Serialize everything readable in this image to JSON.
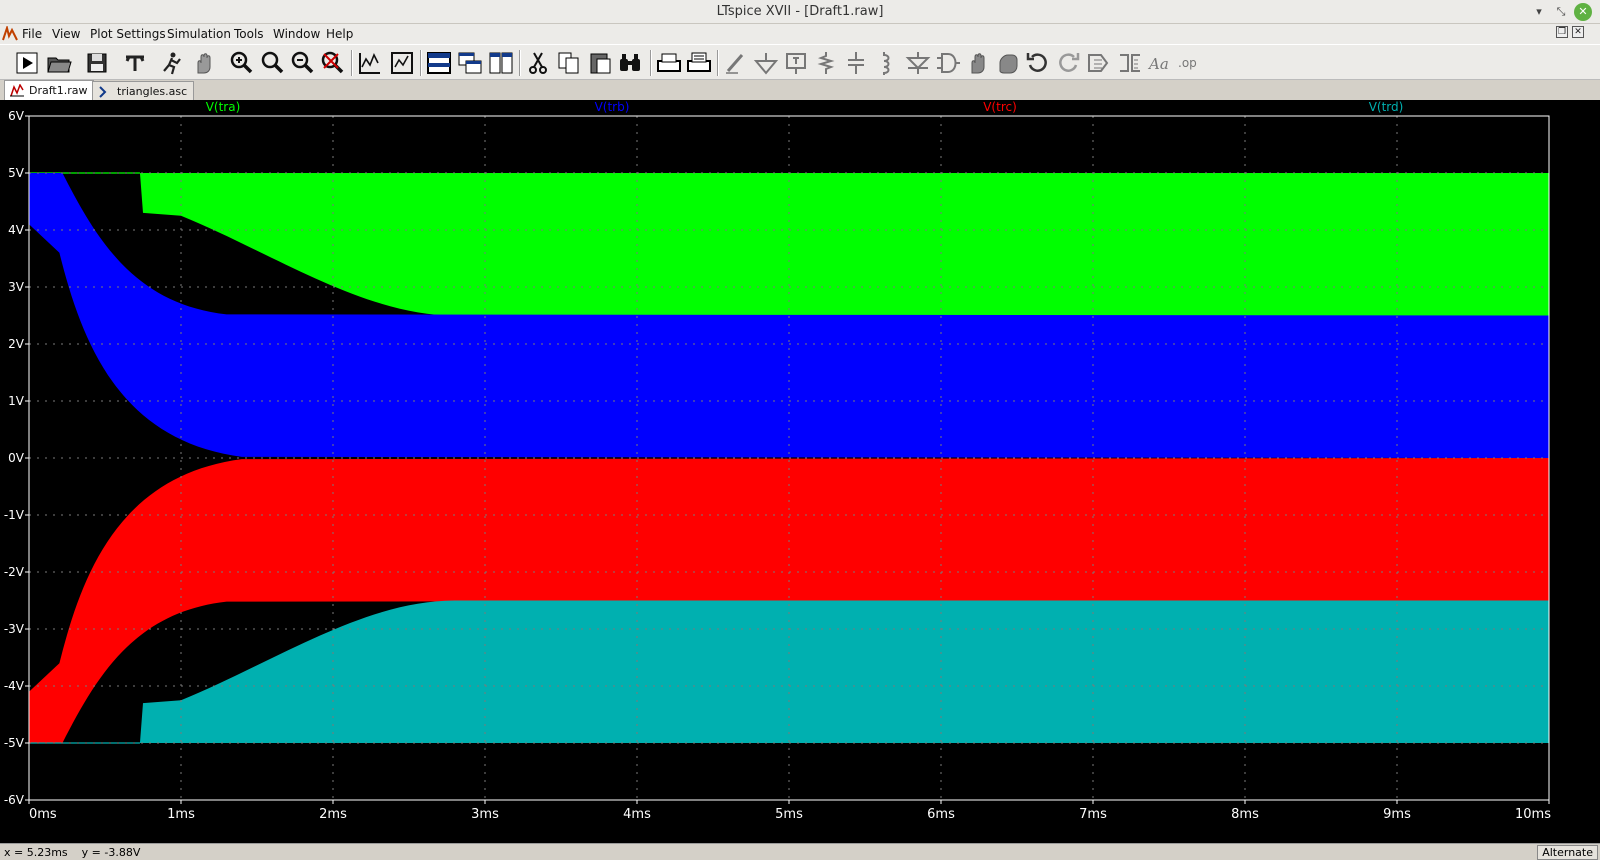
{
  "window": {
    "title": "LTspice XVII - [Draft1.raw]"
  },
  "menu": [
    "File",
    "View",
    "Plot Settings",
    "Simulation",
    "Tools",
    "Window",
    "Help"
  ],
  "tabs": [
    {
      "label": "Draft1.raw",
      "active": true,
      "icon": "waveform-icon"
    },
    {
      "label": "triangles.asc",
      "active": false,
      "icon": "schematic-icon"
    }
  ],
  "toolbar_icons": [
    "run-icon",
    "open-icon",
    "save-icon",
    "control-panel-icon",
    "halt-icon",
    "pan-icon",
    "zoom-in-icon",
    "zoom-full-icon",
    "zoom-out-icon",
    "zoom-cancel-icon",
    "autorange-icon",
    "mark-icon",
    "tile-horizontal-icon",
    "cascade-icon",
    "tile-vertical-icon",
    "cut-icon",
    "copy-icon",
    "paste-icon",
    "find-icon",
    "print-icon",
    "print-preview-icon",
    "wire-icon",
    "ground-icon",
    "label-icon",
    "resistor-icon",
    "capacitor-icon",
    "inductor-icon",
    "diode-icon",
    "component-icon",
    "move-icon",
    "drag-icon",
    "undo-icon",
    "redo-icon",
    "rotate-icon",
    "mirror-icon",
    "text-icon",
    "spice-directive-icon"
  ],
  "chart_data": {
    "type": "area",
    "traces": [
      {
        "name": "V(tra)",
        "color": "#00ff00",
        "settled_band": [
          2.5,
          5.0
        ]
      },
      {
        "name": "V(trb)",
        "color": "#0000ff",
        "settled_band": [
          0.0,
          2.5
        ]
      },
      {
        "name": "V(trc)",
        "color": "#ff0000",
        "settled_band": [
          -2.5,
          0.0
        ]
      },
      {
        "name": "V(trd)",
        "color": "#00b0b0",
        "settled_band": [
          -5.0,
          -2.5
        ]
      }
    ],
    "x_ticks": [
      "0ms",
      "1ms",
      "2ms",
      "3ms",
      "4ms",
      "5ms",
      "6ms",
      "7ms",
      "8ms",
      "9ms",
      "10ms"
    ],
    "y_ticks": [
      "6V",
      "5V",
      "4V",
      "3V",
      "2V",
      "1V",
      "0V",
      "-1V",
      "-2V",
      "-3V",
      "-4V",
      "-5V",
      "-6V"
    ],
    "xlim_ms": [
      0,
      10
    ],
    "ylim_v": [
      -6,
      6
    ],
    "grid": true,
    "background": "#000000"
  },
  "status": {
    "cursor": "x = 5.23ms    y = -3.88V",
    "mode": "Alternate"
  }
}
